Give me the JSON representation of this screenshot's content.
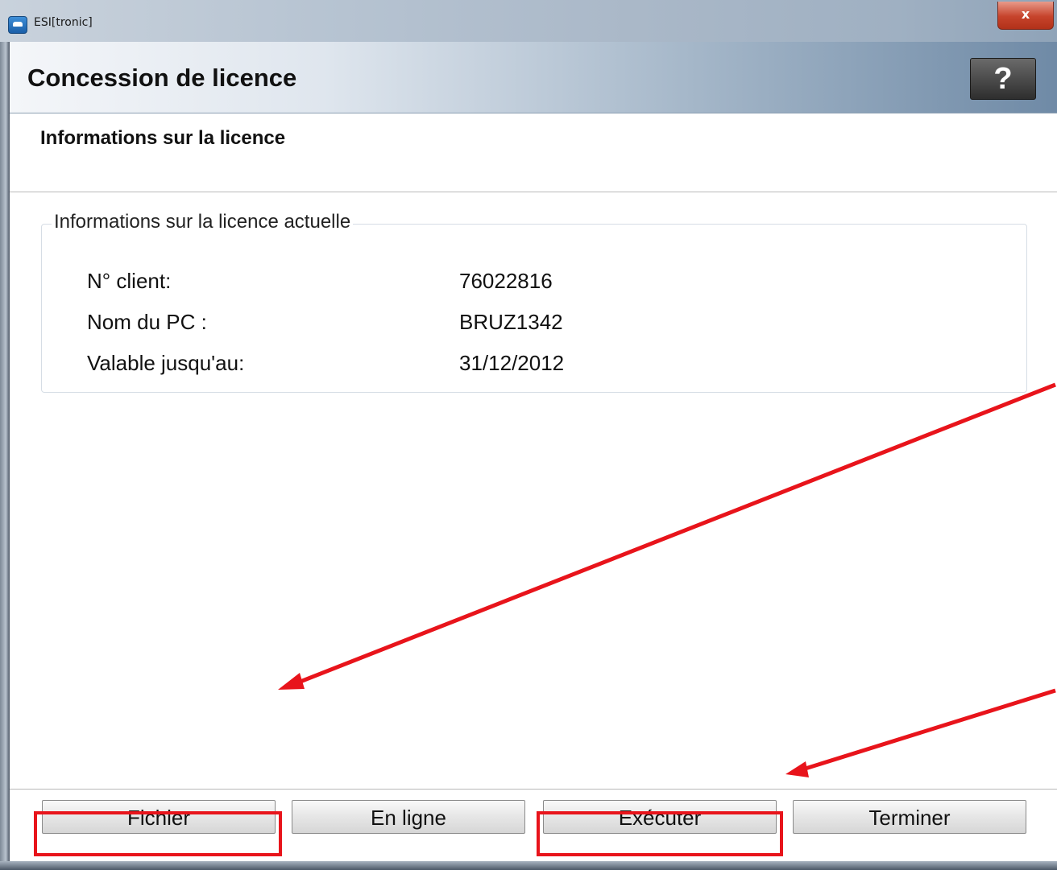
{
  "window": {
    "title": "ESI[tronic]",
    "close_label": "x"
  },
  "header": {
    "title": "Concession de licence",
    "help_label": "?"
  },
  "section": {
    "title": "Informations sur la licence"
  },
  "license_info": {
    "group_label": "Informations sur la licence actuelle",
    "rows": [
      {
        "label": "N° client:",
        "value": "76022816"
      },
      {
        "label": "Nom du PC :",
        "value": "BRUZ1342"
      },
      {
        "label": "Valable jusqu'au:",
        "value": "31/12/2012"
      }
    ]
  },
  "buttons": {
    "file": "Fichier",
    "online": "En ligne",
    "execute": "Exécuter",
    "finish": "Terminer"
  },
  "colors": {
    "annotation_red": "#e8141b"
  }
}
